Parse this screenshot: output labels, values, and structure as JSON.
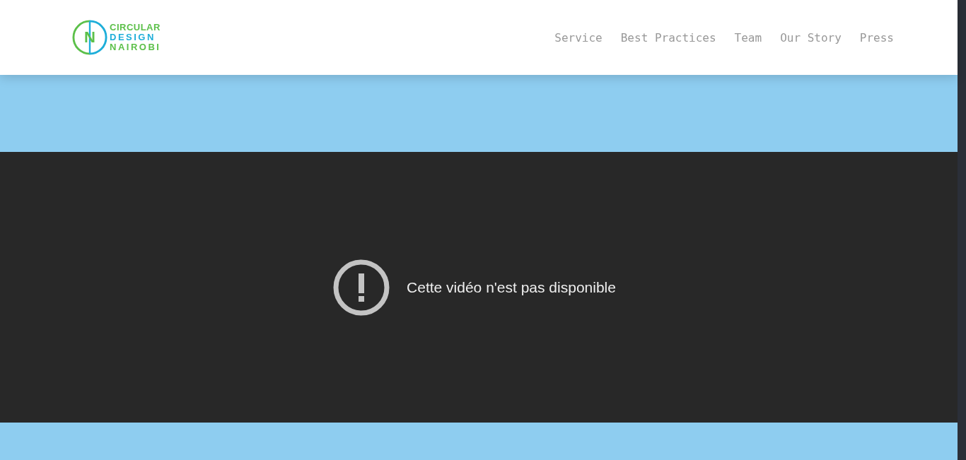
{
  "logo": {
    "mark": "N",
    "lines": [
      "CIRCULAR",
      "DESIGN",
      "NAIROBI"
    ]
  },
  "nav": [
    {
      "label": "Service"
    },
    {
      "label": "Best Practices"
    },
    {
      "label": "Team"
    },
    {
      "label": "Our Story"
    },
    {
      "label": "Press"
    }
  ],
  "video": {
    "message": "Cette vidéo n'est pas disponible"
  }
}
